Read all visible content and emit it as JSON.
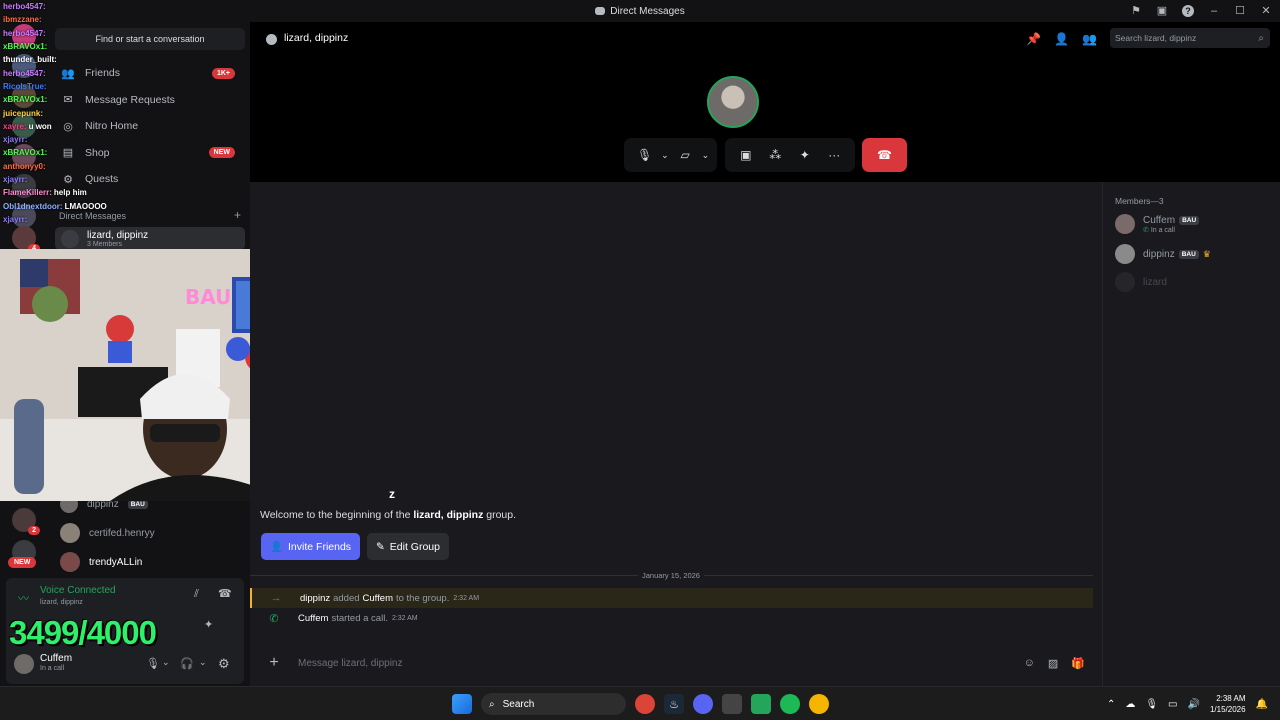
{
  "titlebar": {
    "title": "Direct Messages"
  },
  "sidebar": {
    "search_label": "Find or start a conversation",
    "nav": [
      {
        "label": "Friends",
        "badge": "1K+"
      },
      {
        "label": "Message Requests",
        "badge": ""
      },
      {
        "label": "Nitro Home",
        "badge": ""
      },
      {
        "label": "Shop",
        "badge": "NEW"
      },
      {
        "label": "Quests",
        "badge": ""
      }
    ],
    "dm_header": "Direct Messages",
    "dm_add": "+",
    "active_dm": {
      "name": "lizard, dippinz",
      "sub": "3 Members"
    },
    "dms_lower": [
      {
        "name": "dippinz",
        "tag": "BAU"
      },
      {
        "name": "certifed.henryy",
        "tag": ""
      },
      {
        "name": "trendyALLin",
        "tag": ""
      }
    ],
    "rail_badges": {
      "a": "4",
      "b": "2",
      "new": "NEW"
    }
  },
  "chat_overlay": [
    {
      "user": "herbo4547:",
      "msg": "",
      "color": "#c879ff"
    },
    {
      "user": "ibmzzane:",
      "msg": "",
      "color": "#ff6a3d"
    },
    {
      "user": "herbo4547:",
      "msg": "",
      "color": "#c879ff"
    },
    {
      "user": "xBRAVOx1:",
      "msg": "",
      "color": "#4bff4b"
    },
    {
      "user": "thunder_built:",
      "msg": "",
      "color": "#ffffff"
    },
    {
      "user": "herbo4547:",
      "msg": "",
      "color": "#c879ff"
    },
    {
      "user": "RicoIsTrue:",
      "msg": "",
      "color": "#3d7bff"
    },
    {
      "user": "xBRAVOx1:",
      "msg": "",
      "color": "#4bff4b"
    },
    {
      "user": "juicepunk:",
      "msg": "",
      "color": "#ffd23d"
    },
    {
      "user": "xayre:",
      "msg": "u won",
      "color": "#ff3d8b"
    },
    {
      "user": "xjayrr:",
      "msg": "",
      "color": "#8b7bff"
    },
    {
      "user": "xBRAVOx1:",
      "msg": "",
      "color": "#4bff4b"
    },
    {
      "user": "anthonyy0:",
      "msg": "",
      "color": "#ff6a3d"
    },
    {
      "user": "xjayrr:",
      "msg": "",
      "color": "#8b7bff"
    },
    {
      "user": "FlameKillerr:",
      "msg": "help him",
      "color": "#ff8bd0"
    },
    {
      "user": "Obl1dnextdoor:",
      "msg": "LMAOOOO",
      "color": "#8bb0ff"
    },
    {
      "user": "xjayrr:",
      "msg": "",
      "color": "#8b7bff"
    }
  ],
  "voice": {
    "title": "Voice Connected",
    "sub": "lizard, dippinz",
    "counter": "3499/4000",
    "user_name": "Cuffem",
    "user_sub": "In a call"
  },
  "call": {
    "title": "lizard, dippinz",
    "search_placeholder": "Search lizard, dippinz"
  },
  "main": {
    "welcome_tail": "z",
    "welcome_pre": "Welcome to the beginning of the ",
    "welcome_group": "lizard, dippinz",
    "welcome_post": " group.",
    "invite_label": "Invite Friends",
    "edit_label": "Edit Group",
    "date": "January 15, 2026",
    "sys1": {
      "actor": "dippinz",
      "verb": "added",
      "target": "Cuffem",
      "rest": "to the group.",
      "time": "2:32 AM"
    },
    "sys2": {
      "actor": "Cuffem",
      "rest": "started a call.",
      "time": "2:32 AM"
    },
    "input_placeholder": "Message lizard, dippinz"
  },
  "members": {
    "header": "Members—3",
    "list": [
      {
        "name": "Cuffem",
        "tag": "BAU",
        "sub": "In a call"
      },
      {
        "name": "dippinz",
        "tag": "BAU",
        "sub": ""
      },
      {
        "name": "lizard",
        "tag": "",
        "sub": ""
      }
    ]
  },
  "taskbar": {
    "search_label": "Search",
    "time": "2:38 AM",
    "date": "1/15/2026"
  },
  "colors": {
    "accent": "#5865f2",
    "danger": "#da373c",
    "online": "#23a55a",
    "counter": "#2ef06a"
  }
}
